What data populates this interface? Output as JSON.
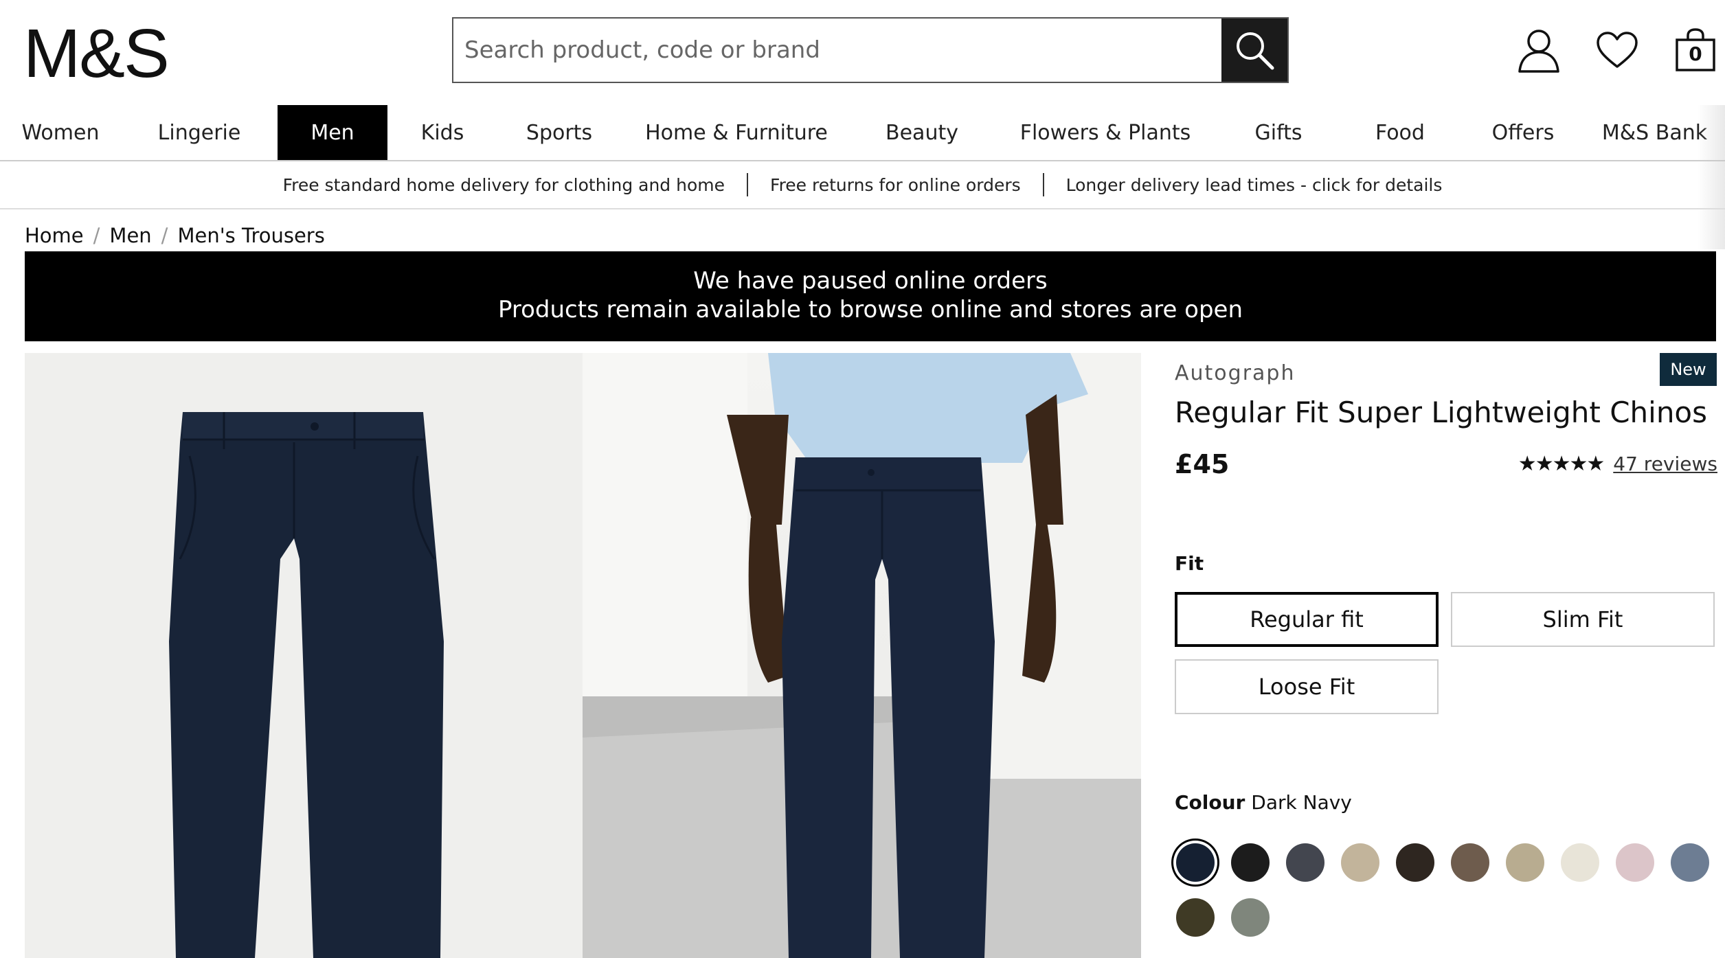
{
  "header": {
    "logo": "M&S",
    "search_placeholder": "Search product, code or brand",
    "bag_count": "0"
  },
  "nav": {
    "items": [
      {
        "label": "Women"
      },
      {
        "label": "Lingerie"
      },
      {
        "label": "Men",
        "active": true
      },
      {
        "label": "Kids"
      },
      {
        "label": "Sports"
      },
      {
        "label": "Home & Furniture"
      },
      {
        "label": "Beauty"
      },
      {
        "label": "Flowers & Plants"
      },
      {
        "label": "Gifts"
      },
      {
        "label": "Food"
      },
      {
        "label": "Offers"
      },
      {
        "label": "M&S Bank"
      }
    ]
  },
  "delivery": {
    "messages": [
      "Free standard home delivery for clothing and home",
      "Free returns for online orders",
      "Longer delivery lead times - click for details"
    ]
  },
  "breadcrumb": [
    "Home",
    "Men",
    "Men's Trousers"
  ],
  "notice": {
    "line1": "We have paused online orders",
    "line2": "Products remain available to browse online and stores are open"
  },
  "product": {
    "brand": "Autograph",
    "badge": "New",
    "title": "Regular Fit Super Lightweight Chinos",
    "price": "£45",
    "rating": 4.5,
    "stars": "★★★★★",
    "reviews": "47 reviews",
    "fit_label": "Fit",
    "fits": [
      {
        "label": "Regular fit",
        "selected": true
      },
      {
        "label": "Slim Fit"
      },
      {
        "label": "Loose Fit"
      }
    ],
    "colour_label": "Colour",
    "colour_value": "Dark Navy",
    "colours": [
      {
        "name": "Dark Navy",
        "hex": "#152032",
        "selected": true
      },
      {
        "name": "Black",
        "hex": "#1c1c1c"
      },
      {
        "name": "Charcoal",
        "hex": "#43464f"
      },
      {
        "name": "Stone",
        "hex": "#c2b49b"
      },
      {
        "name": "Dark Brown",
        "hex": "#2e2620"
      },
      {
        "name": "Brown",
        "hex": "#6e5c4d"
      },
      {
        "name": "Sand",
        "hex": "#b8ac90"
      },
      {
        "name": "Ecru",
        "hex": "#e8e4d8"
      },
      {
        "name": "Pink",
        "hex": "#dcc5c9"
      },
      {
        "name": "Blue Grey",
        "hex": "#6d7d93"
      },
      {
        "name": "Olive",
        "hex": "#3f3a25"
      },
      {
        "name": "Sage",
        "hex": "#7f867c"
      }
    ]
  }
}
